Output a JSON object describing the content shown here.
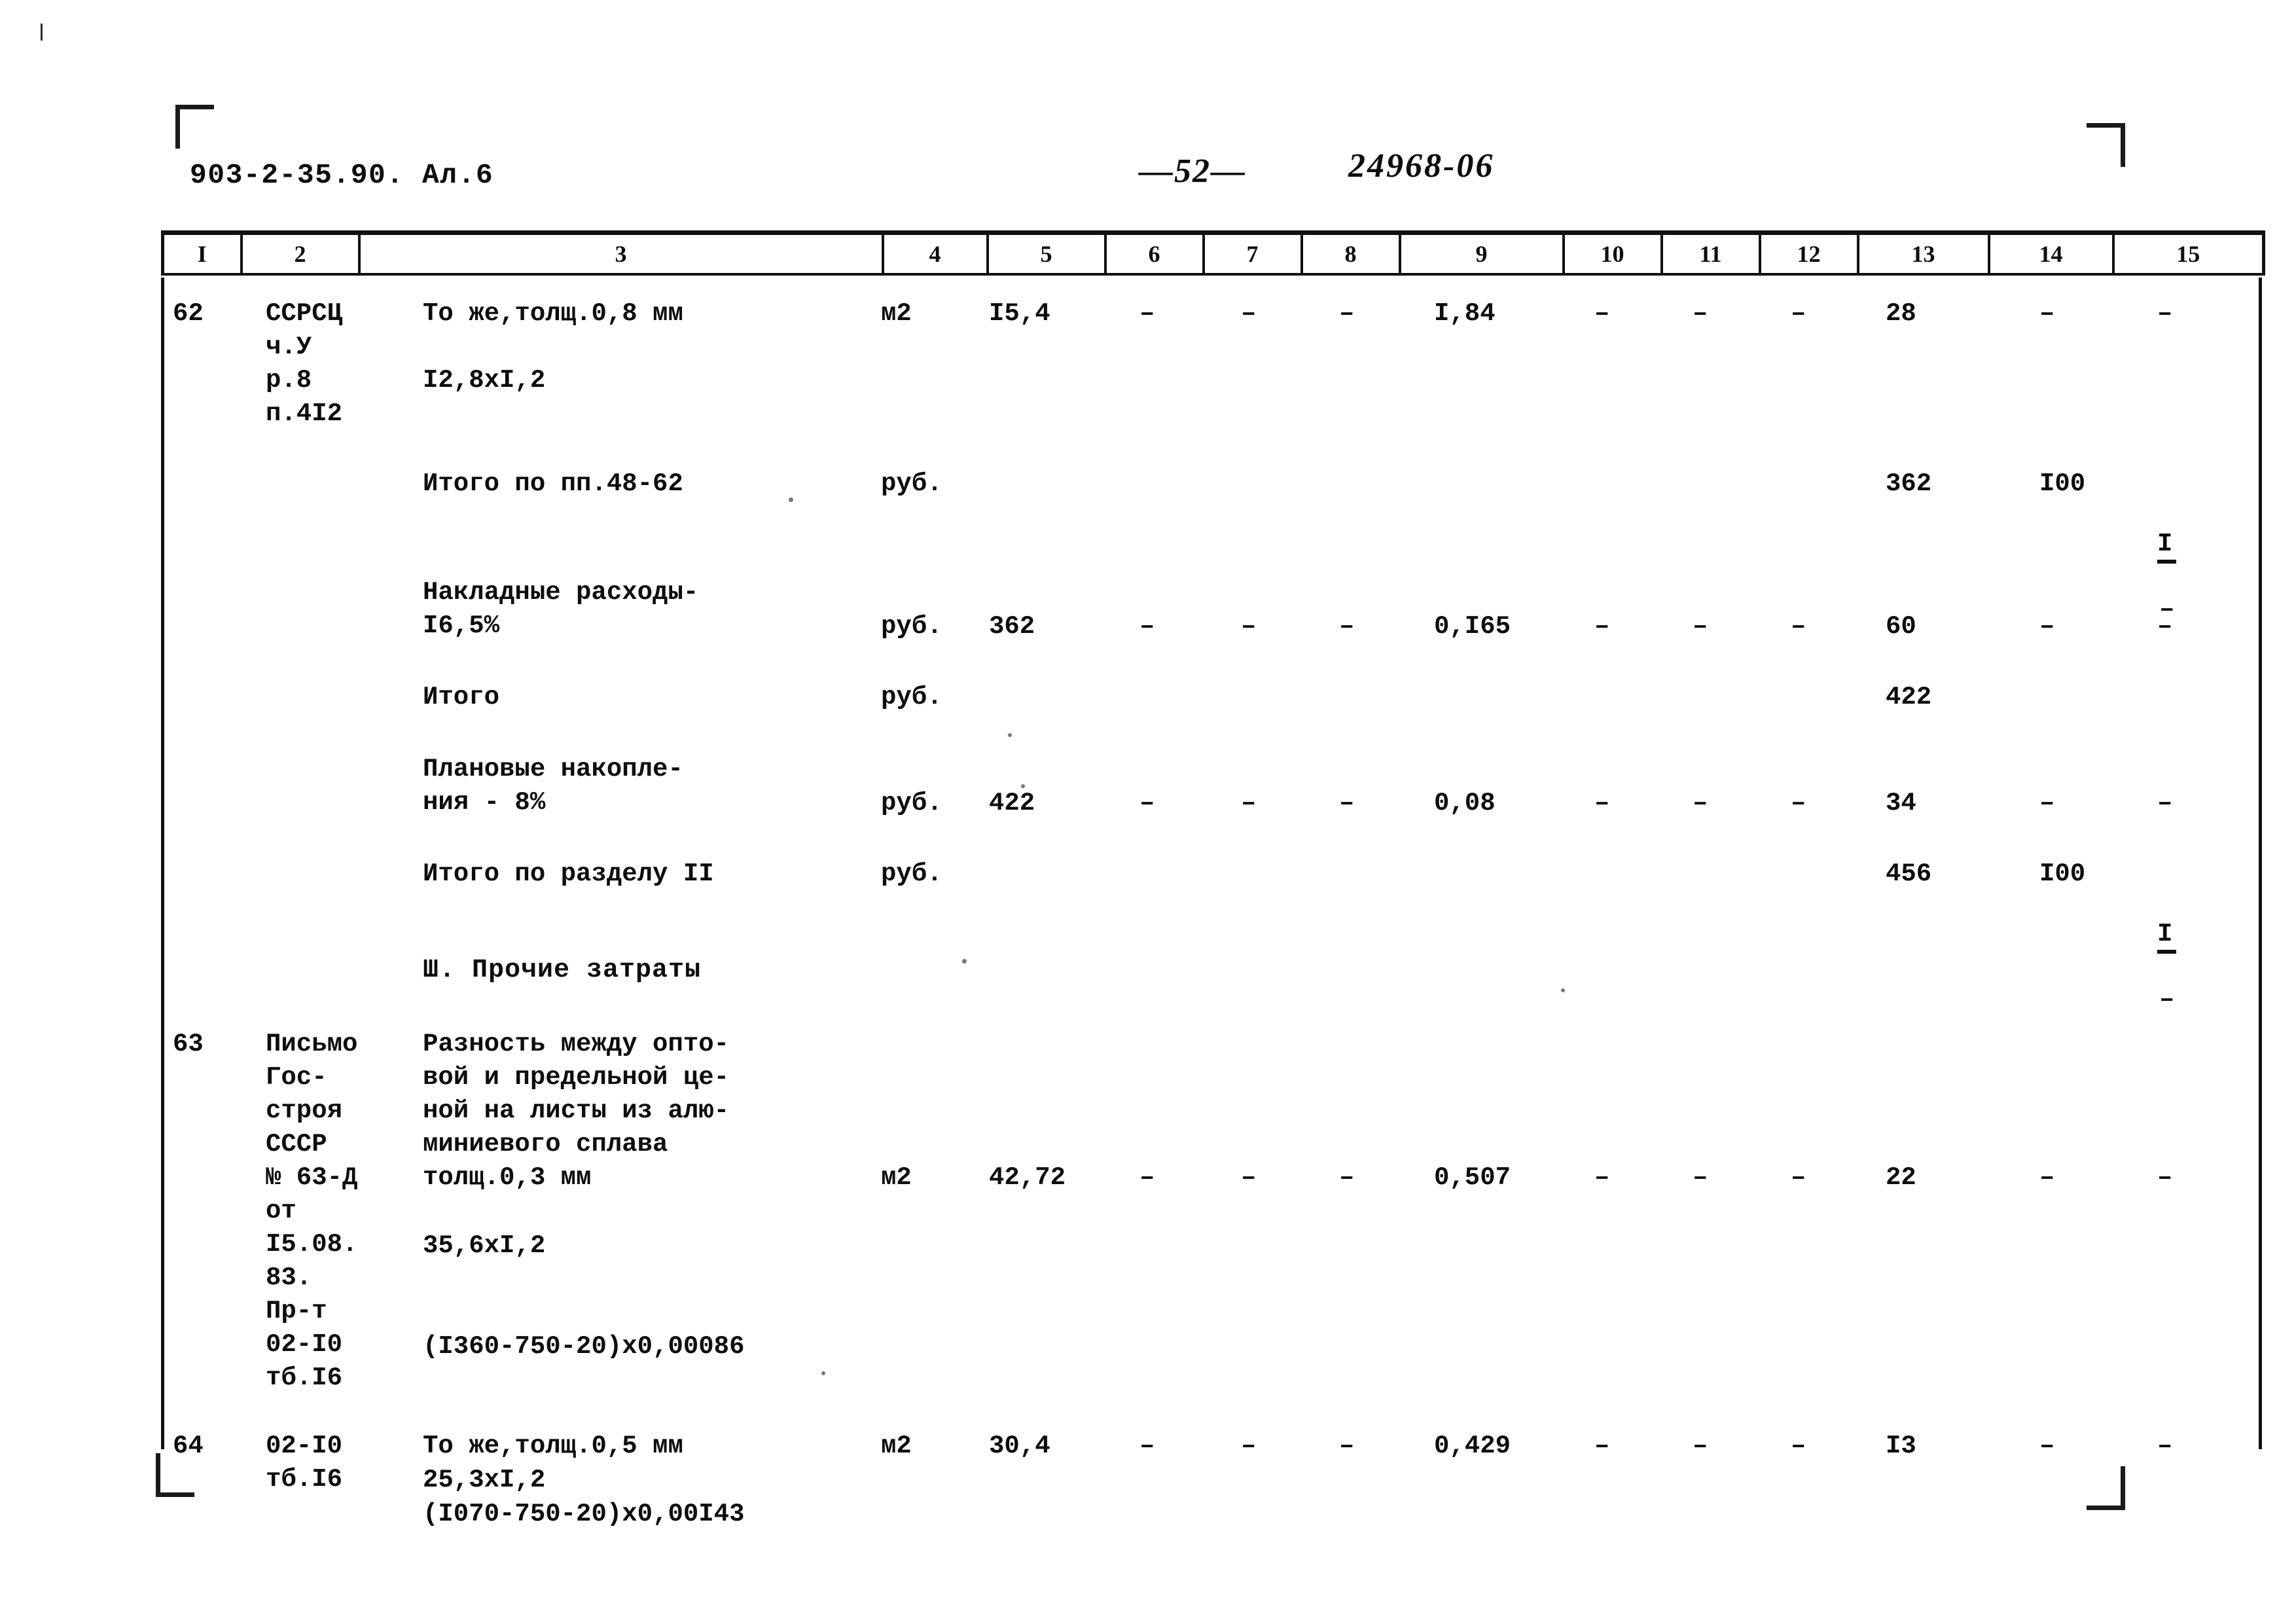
{
  "header": {
    "doc_code": "903-2-35.90. Ал.6",
    "page_number": "—52—",
    "archive_number": "24968-06"
  },
  "table": {
    "column_numbers": [
      "I",
      "2",
      "3",
      "4",
      "5",
      "6",
      "7",
      "8",
      "9",
      "10",
      "11",
      "12",
      "13",
      "14",
      "15"
    ],
    "rows": [
      {
        "id": "row-62",
        "num": "62",
        "ref": "ССРСЦ\nч.У\nр.8\nп.4I2",
        "desc": "То же,толщ.0,8 мм",
        "desc2": "I2,8xI,2",
        "unit": "м2",
        "c5": "I5,4",
        "c6": "–",
        "c7": "–",
        "c8": "–",
        "c9": "I,84",
        "c10": "–",
        "c11": "–",
        "c12": "–",
        "c13": "28",
        "c14": "–",
        "c15": "–"
      },
      {
        "id": "row-itogo-48-62",
        "num": "",
        "ref": "",
        "desc": "Итого по пп.48-62",
        "unit": "руб.",
        "c5": "",
        "c13": "362",
        "c14": "I00",
        "c15_fraction": {
          "numerator": "I",
          "denominator": "–"
        }
      },
      {
        "id": "row-overhead",
        "num": "",
        "ref": "",
        "desc": "Накладные расходы-\nI6,5%",
        "unit": "руб.",
        "c5": "362",
        "c6": "–",
        "c7": "–",
        "c8": "–",
        "c9": "0,I65",
        "c10": "–",
        "c11": "–",
        "c12": "–",
        "c13": "60",
        "c14": "–",
        "c15": "–"
      },
      {
        "id": "row-itogo-1",
        "num": "",
        "ref": "",
        "desc": "Итого",
        "unit": "руб.",
        "c13": "422"
      },
      {
        "id": "row-planned-savings",
        "num": "",
        "ref": "",
        "desc": "Плановые накопле-\nния - 8%",
        "unit": "руб.",
        "c5": "422",
        "c6": "–",
        "c7": "–",
        "c8": "–",
        "c9": "0,08",
        "c10": "–",
        "c11": "–",
        "c12": "–",
        "c13": "34",
        "c14": "–",
        "c15": "–"
      },
      {
        "id": "row-itogo-razdel",
        "num": "",
        "ref": "",
        "desc": "Итого по разделу II",
        "unit": "руб.",
        "c13": "456",
        "c14": "I00",
        "c15_fraction": {
          "numerator": "I",
          "denominator": "–"
        }
      },
      {
        "id": "row-63",
        "num": "63",
        "ref": "Письмо\nГос-\nстроя\nСССР\n№ 63-Д\nот\nI5.08.\n83.\nПр-т\n02-I0\nтб.I6",
        "desc": "Разность между опто-\nвой и предельной це-\nной на листы из алю-\nминиевого сплава\nтолщ.0,3 мм",
        "desc2": "35,6xI,2",
        "desc3": "(I360-750-20)x0,00086",
        "unit": "м2",
        "c5": "42,72",
        "c6": "–",
        "c7": "–",
        "c8": "–",
        "c9": "0,507",
        "c10": "–",
        "c11": "–",
        "c12": "–",
        "c13": "22",
        "c14": "–",
        "c15": "–"
      },
      {
        "id": "row-64",
        "num": "64",
        "ref": "02-I0\nтб.I6",
        "desc": "То же,толщ.0,5 мм",
        "desc2": "25,3xI,2",
        "desc3": "(I070-750-20)x0,00I43",
        "unit": "м2",
        "c5": "30,4",
        "c6": "–",
        "c7": "–",
        "c8": "–",
        "c9": "0,429",
        "c10": "–",
        "c11": "–",
        "c12": "–",
        "c13": "I3",
        "c14": "–",
        "c15": "–"
      }
    ],
    "section_heading": "Ш. Прочие затраты"
  }
}
